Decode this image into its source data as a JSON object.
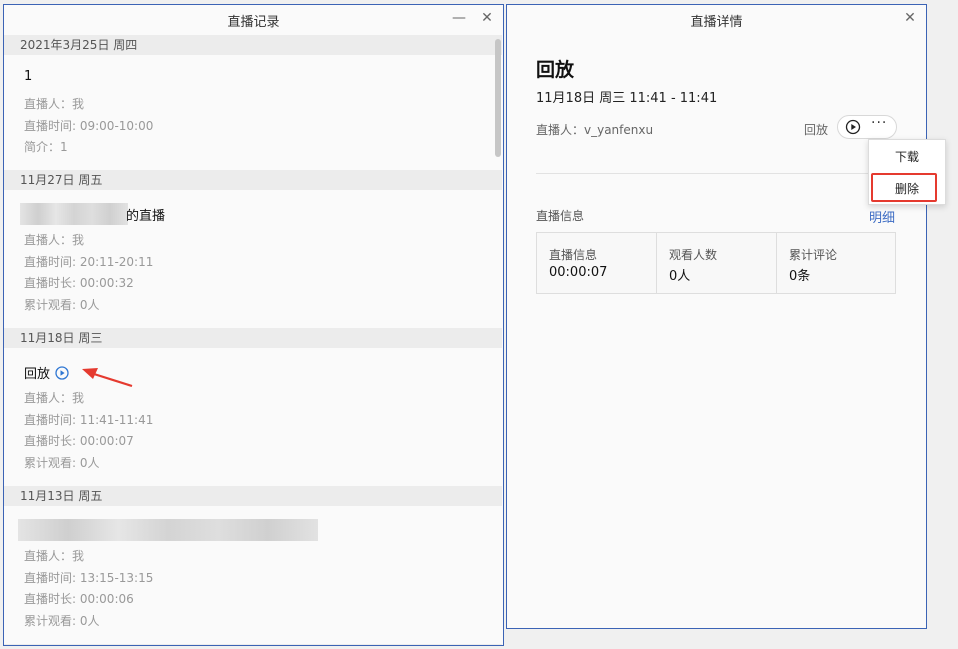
{
  "left_window": {
    "title": "直播记录",
    "minimize_symbol": "—",
    "close_symbol": "✕",
    "groups": [
      {
        "date": "2021年3月25日 周四",
        "title": "1",
        "lines": [
          "直播人：我",
          "直播时间: 09:00-10:00",
          "简介：1"
        ]
      },
      {
        "date": "11月27日 周五",
        "title_suffix": "的直播",
        "lines": [
          "直播人：我",
          "直播时间: 20:11-20:11",
          "直播时长: 00:00:32",
          "累计观看: 0人"
        ]
      },
      {
        "date": "11月18日 周三",
        "title": "回放",
        "lines": [
          "直播人：我",
          "直播时间: 11:41-11:41",
          "直播时长: 00:00:07",
          "累计观看: 0人"
        ]
      },
      {
        "date": "11月13日 周五",
        "lines": [
          "直播人：我",
          "直播时间: 13:15-13:15",
          "直播时长: 00:00:06",
          "累计观看: 0人"
        ]
      }
    ]
  },
  "right_window": {
    "title": "直播详情",
    "close_symbol": "✕",
    "heading": "回放",
    "datetime": "11月18日 周三 11:41 - 11:41",
    "host": "直播人：v_yanfenxu",
    "replay_label": "回放",
    "more_symbol": "···",
    "info_title": "直播信息",
    "detail_link": "明细",
    "stats": [
      {
        "label": "直播信息",
        "value": "00:00:07"
      },
      {
        "label": "观看人数",
        "value": "0人"
      },
      {
        "label": "累计评论",
        "value": "0条"
      }
    ]
  },
  "menu": {
    "items": [
      "下载",
      "删除"
    ]
  },
  "colors": {
    "window_border": "#3b63b5",
    "link": "#3e6dc4",
    "highlight_box": "#e53a2f",
    "annotation_arrow": "#e53a2f",
    "play_icon": "#2f77d3"
  },
  "icons": {
    "replay_play": "play-circle-icon",
    "pill_play": "play-circle-icon",
    "annotation": "red-arrow-icon"
  }
}
